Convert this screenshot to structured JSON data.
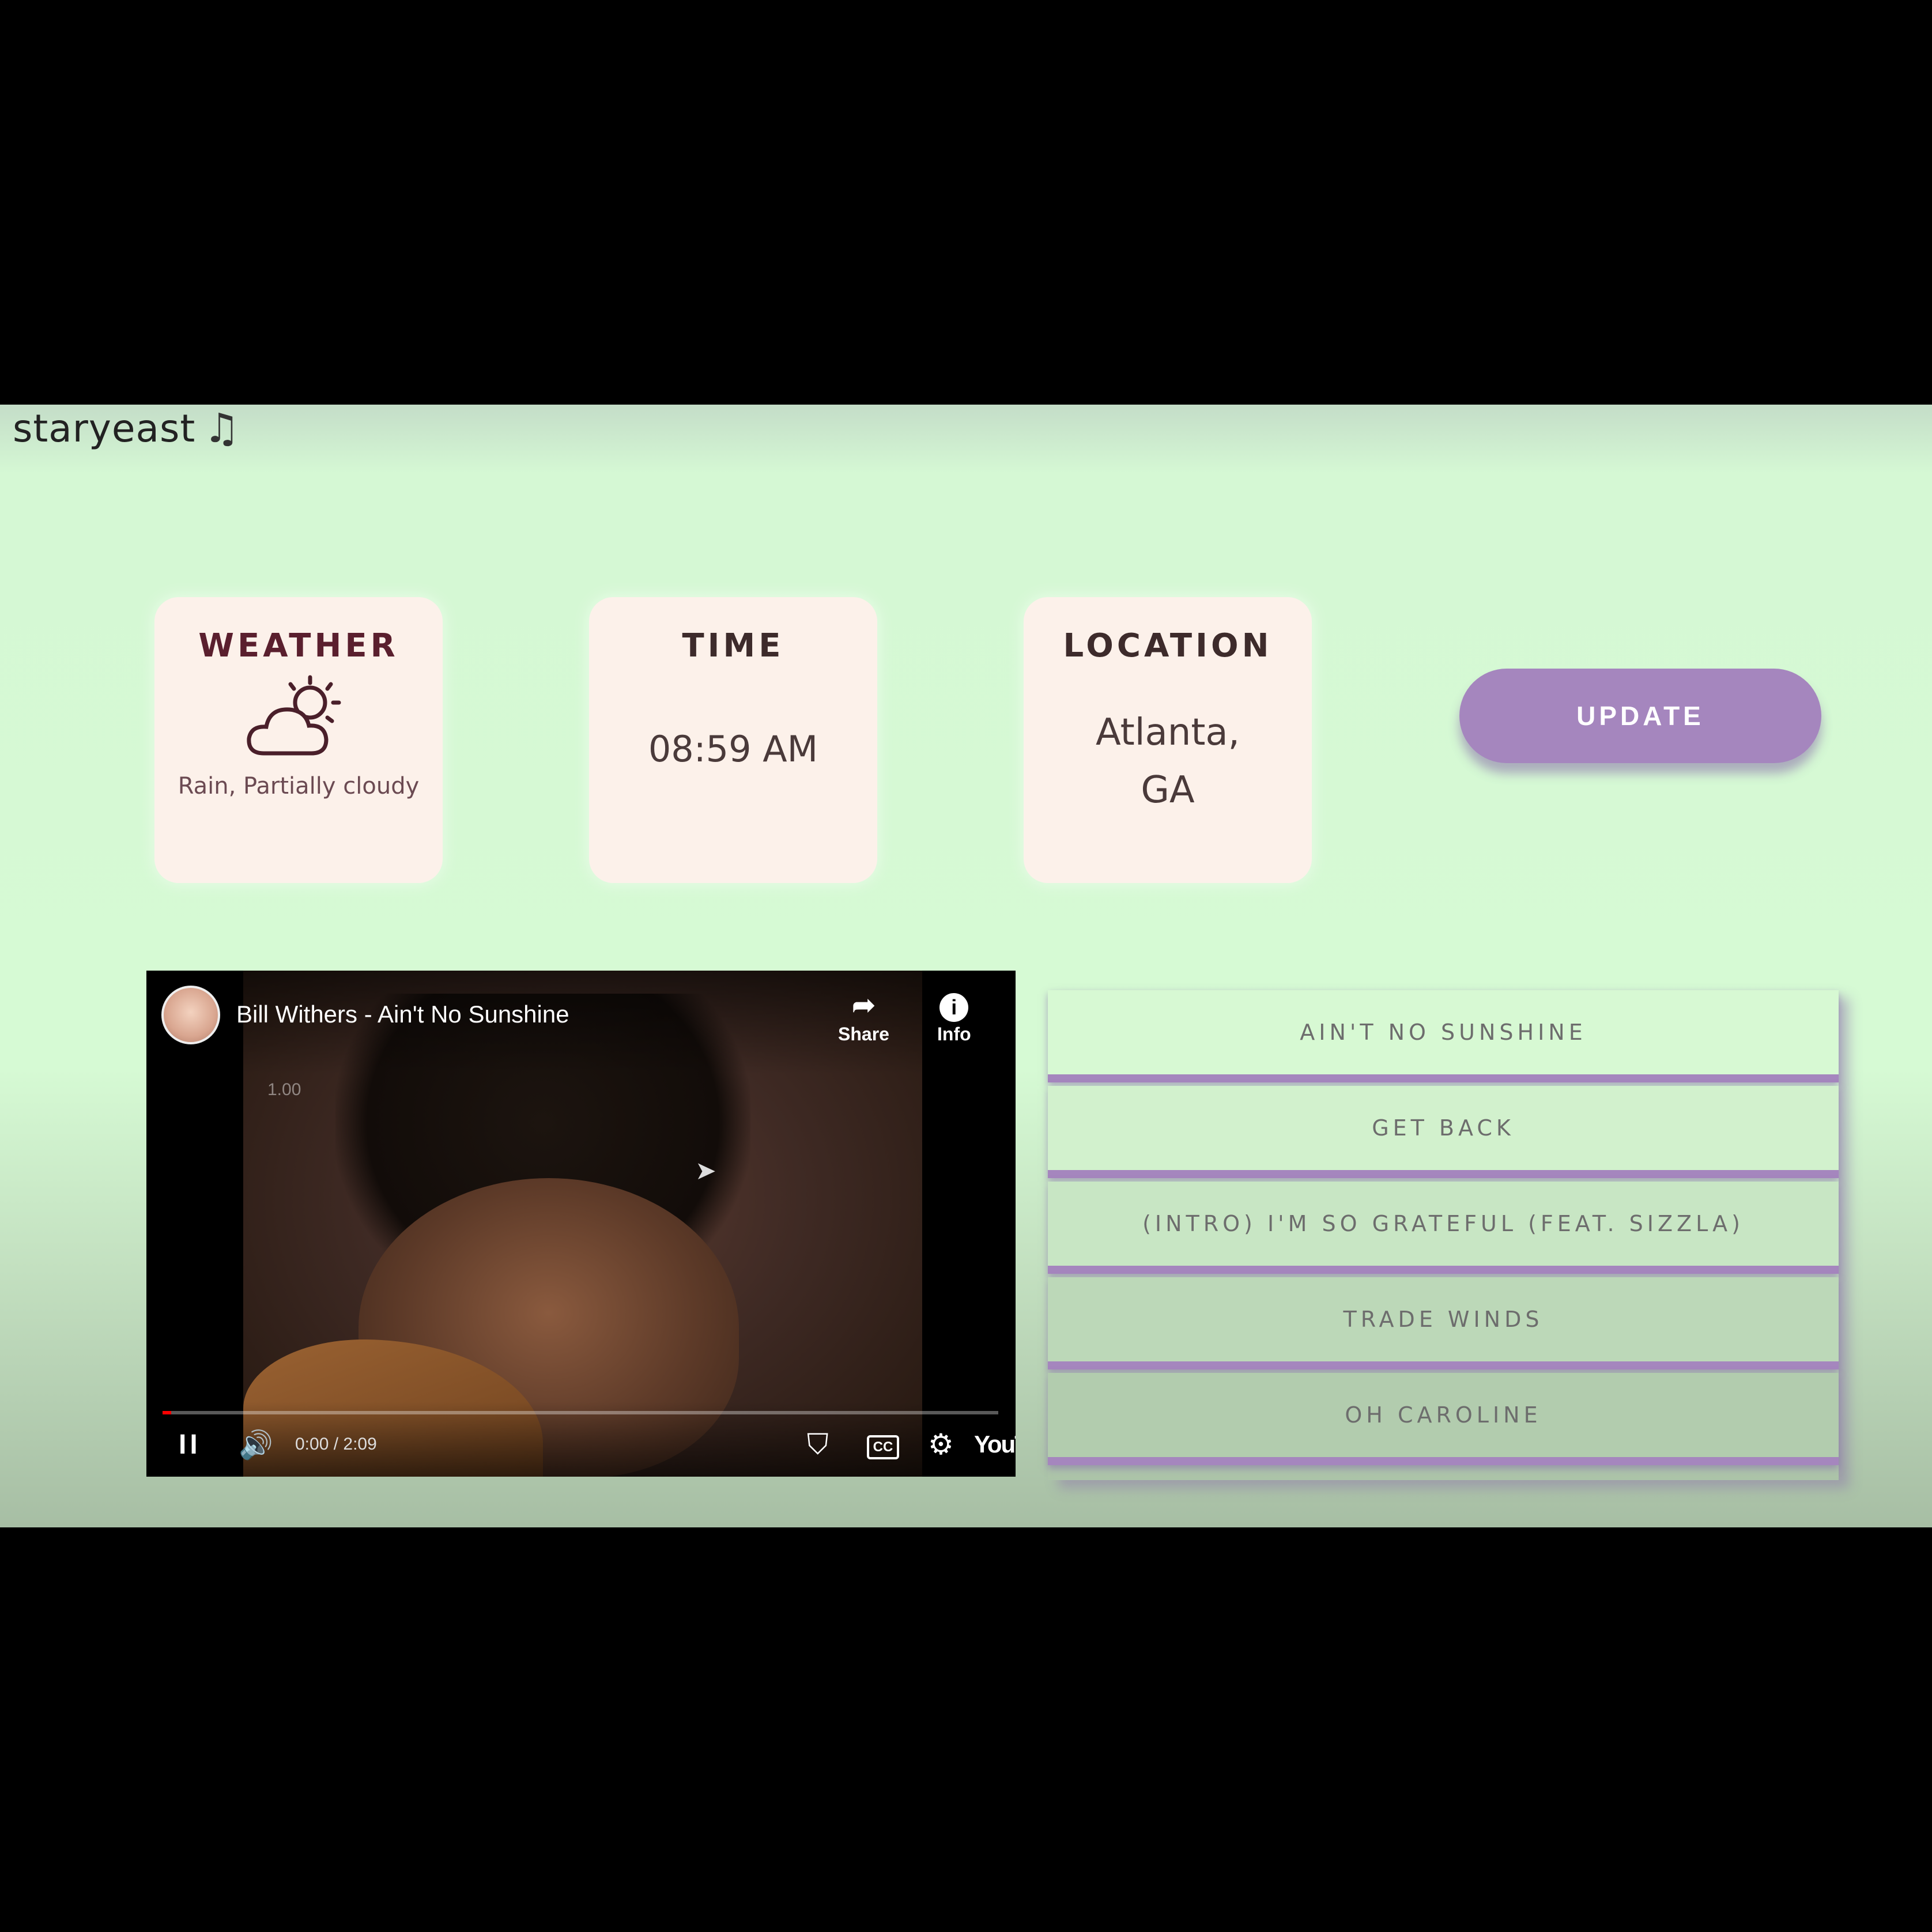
{
  "brand": {
    "name": "staryeast",
    "icon": "music-note-icon",
    "glyph": "♫"
  },
  "cards": {
    "weather": {
      "title": "WEATHER",
      "icon": "partly-cloudy-icon",
      "description": "Rain, Partially cloudy"
    },
    "time": {
      "title": "TIME",
      "value": "08:59 AM"
    },
    "location": {
      "title": "LOCATION",
      "value": "Atlanta,\nGA"
    }
  },
  "update_button": {
    "label": "UPDATE",
    "color": "#a586be"
  },
  "video": {
    "title": "Bill Withers - Ain't No Sunshine",
    "share_label": "Share",
    "info_label": "Info",
    "speed_overlay": "1.00",
    "time_display": "0:00 / 2:09",
    "progress": 0.01,
    "logo_text": "YouTube",
    "icons": [
      "pause-icon",
      "volume-icon",
      "shield-icon",
      "captions-icon",
      "settings-icon",
      "fullscreen-icon",
      "share-icon",
      "info-icon"
    ]
  },
  "playlist": {
    "tracks": [
      "AIN'T NO SUNSHINE",
      "GET BACK",
      "(INTRO) I'M SO GRATEFUL (FEAT. SIZZLA)",
      "TRADE WINDS",
      "OH CAROLINE"
    ],
    "accent_color": "#a586be"
  },
  "colors": {
    "background": "#d6fad4",
    "card": "#fcf1ea",
    "letterbox": "#000000"
  }
}
